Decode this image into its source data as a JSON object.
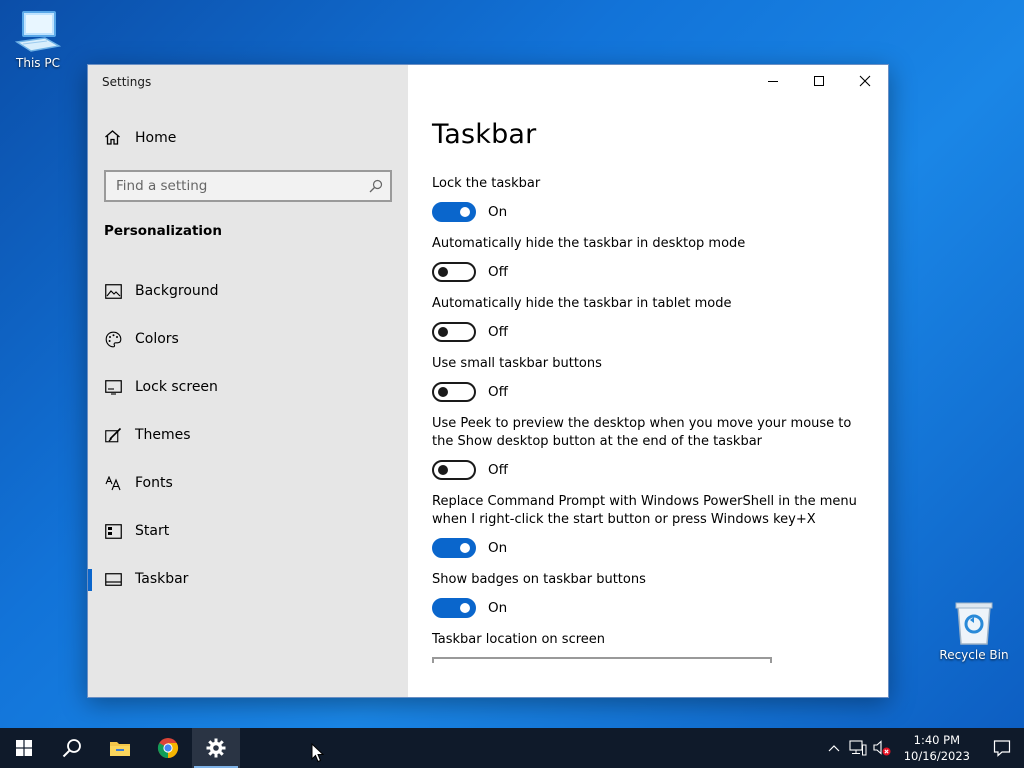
{
  "desktop": {
    "this_pc_label": "This PC",
    "recycle_bin_label": "Recycle Bin"
  },
  "window": {
    "app_title": "Settings",
    "home_label": "Home",
    "search": {
      "placeholder": "Find a setting"
    },
    "section_heading": "Personalization",
    "nav_items": [
      {
        "label": "Background",
        "icon": "picture-icon"
      },
      {
        "label": "Colors",
        "icon": "palette-icon"
      },
      {
        "label": "Lock screen",
        "icon": "lock-screen-icon"
      },
      {
        "label": "Themes",
        "icon": "brush-icon"
      },
      {
        "label": "Fonts",
        "icon": "font-icon"
      },
      {
        "label": "Start",
        "icon": "start-grid-icon"
      },
      {
        "label": "Taskbar",
        "icon": "taskbar-icon",
        "active": true
      }
    ]
  },
  "page": {
    "title": "Taskbar",
    "settings": [
      {
        "label": "Lock the taskbar",
        "state": "On"
      },
      {
        "label": "Automatically hide the taskbar in desktop mode",
        "state": "Off"
      },
      {
        "label": "Automatically hide the taskbar in tablet mode",
        "state": "Off"
      },
      {
        "label": "Use small taskbar buttons",
        "state": "Off"
      },
      {
        "label": "Use Peek to preview the desktop when you move your mouse to the Show desktop button at the end of the taskbar",
        "state": "Off"
      },
      {
        "label": "Replace Command Prompt with Windows PowerShell in the menu when I right-click the start button or press Windows key+X",
        "state": "On"
      },
      {
        "label": "Show badges on taskbar buttons",
        "state": "On"
      }
    ],
    "location_label": "Taskbar location on screen"
  },
  "taskbar": {
    "time": "1:40 PM",
    "date": "10/16/2023"
  },
  "colors": {
    "accent": "#0a66cc",
    "sidebar_bg": "#e6e6e6",
    "taskbar_bg": "#0f1a2a"
  }
}
